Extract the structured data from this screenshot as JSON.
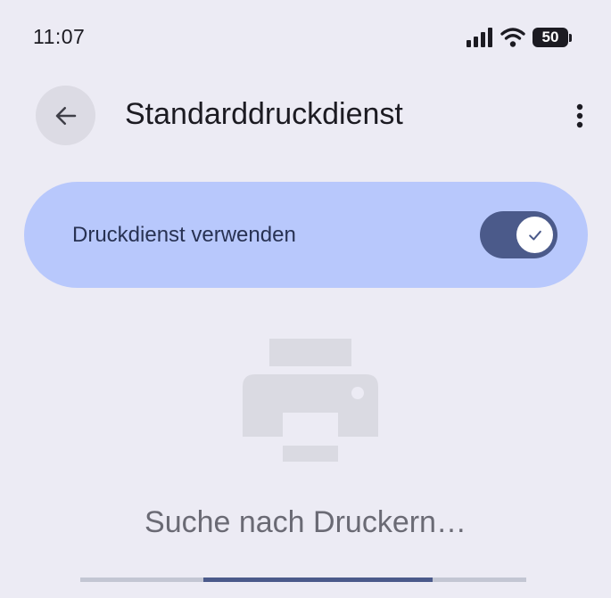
{
  "status_bar": {
    "time": "11:07",
    "battery_level": "50",
    "icons": [
      "signal-icon",
      "wifi-icon",
      "battery-icon"
    ]
  },
  "app_bar": {
    "title": "Standarddruckdienst",
    "back_icon": "arrow-back-icon",
    "more_icon": "more-vert-icon"
  },
  "main_switch": {
    "label": "Druckdienst verwenden",
    "checked": true
  },
  "empty_state": {
    "icon": "printer-icon",
    "message": "Suche nach Druckern…"
  },
  "progress": {
    "indeterminate": true
  },
  "colors": {
    "background": "#ecebf4",
    "switch_container": "#b8c8fc",
    "accent": "#4b5a8a",
    "placeholder_icon": "#dadae2"
  }
}
